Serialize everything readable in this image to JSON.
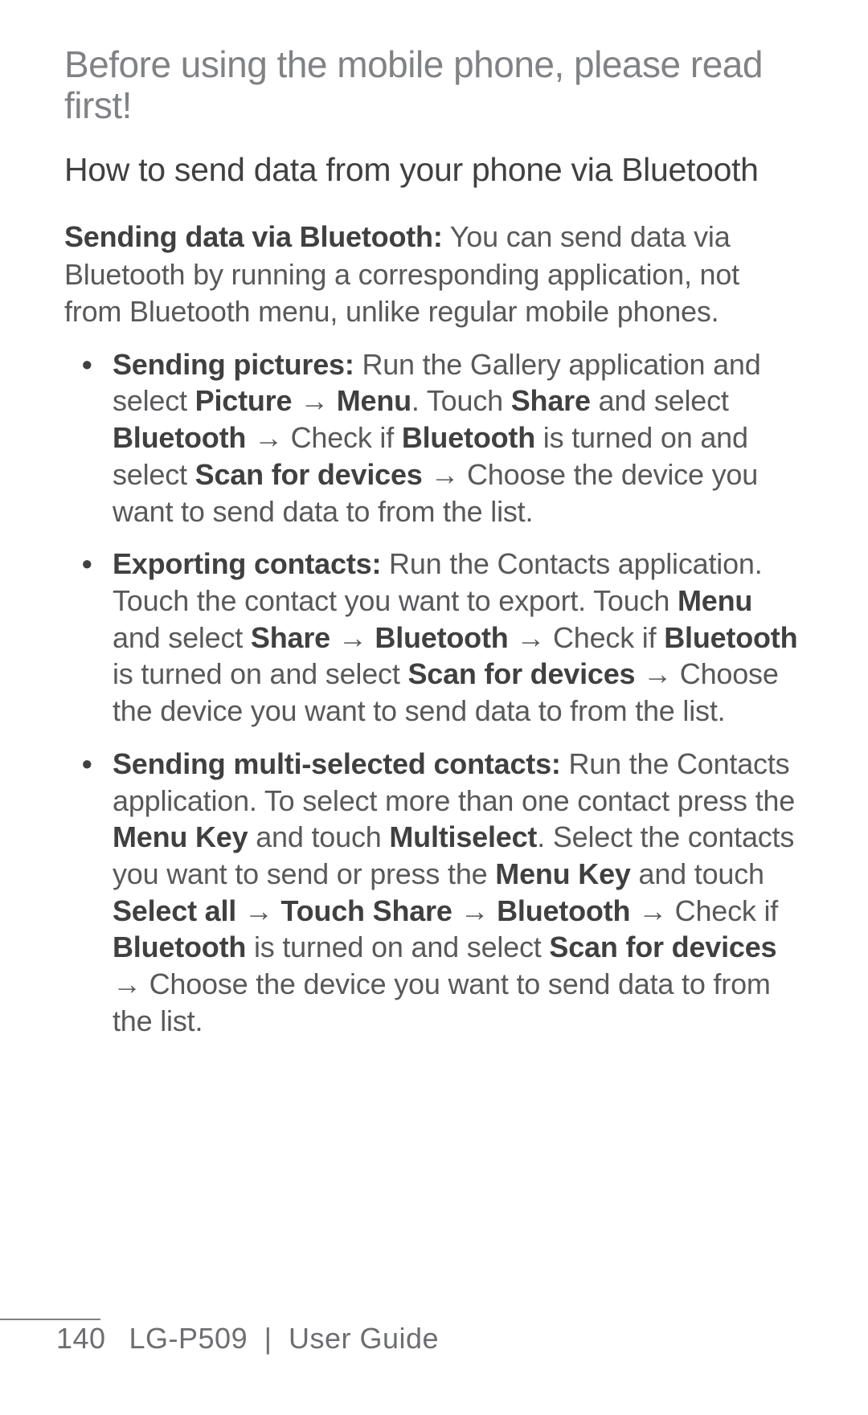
{
  "title": "Before using the mobile phone, please read first!",
  "subtitle": "How to send data from your phone via Bluetooth",
  "intro": {
    "lead_bold": "Sending data via Bluetooth:",
    "lead_rest": " You can send data via Bluetooth by running a corresponding application, not from Bluetooth menu, unlike regular mobile phones."
  },
  "items": [
    {
      "parts": [
        {
          "t": "Sending pictures:",
          "b": true
        },
        {
          "t": " Run the Gallery application and select "
        },
        {
          "t": "Picture",
          "b": true
        },
        {
          "t": " → "
        },
        {
          "t": "Menu",
          "b": true
        },
        {
          "t": ". Touch "
        },
        {
          "t": "Share",
          "b": true
        },
        {
          "t": " and select "
        },
        {
          "t": "Bluetooth",
          "b": true
        },
        {
          "t": " → Check if "
        },
        {
          "t": "Bluetooth",
          "b": true
        },
        {
          "t": " is turned on and select "
        },
        {
          "t": "Scan for devices",
          "b": true
        },
        {
          "t": " → Choose the device you want to send data to from the list."
        }
      ]
    },
    {
      "parts": [
        {
          "t": "Exporting contacts:",
          "b": true
        },
        {
          "t": " Run the Contacts application. Touch the contact you want to export. Touch "
        },
        {
          "t": "Menu",
          "b": true
        },
        {
          "t": " and select "
        },
        {
          "t": "Share",
          "b": true
        },
        {
          "t": " → "
        },
        {
          "t": "Bluetooth",
          "b": true
        },
        {
          "t": " → Check if "
        },
        {
          "t": "Bluetooth",
          "b": true
        },
        {
          "t": " is turned on and select "
        },
        {
          "t": "Scan for devices",
          "b": true
        },
        {
          "t": " → Choose the device you want to send data to from the list."
        }
      ]
    },
    {
      "parts": [
        {
          "t": "Sending multi-selected contacts:",
          "b": true
        },
        {
          "t": " Run the Contacts application. To select more than one contact press the "
        },
        {
          "t": "Menu Key",
          "b": true
        },
        {
          "t": " and touch "
        },
        {
          "t": "Multiselect",
          "b": true
        },
        {
          "t": ". Select the contacts you want to send or press the "
        },
        {
          "t": "Menu Key",
          "b": true
        },
        {
          "t": " and touch "
        },
        {
          "t": "Select all",
          "b": true
        },
        {
          "t": " → "
        },
        {
          "t": "Touch Share",
          "b": true
        },
        {
          "t": " → "
        },
        {
          "t": "Bluetooth",
          "b": true
        },
        {
          "t": " → Check if "
        },
        {
          "t": "Bluetooth",
          "b": true
        },
        {
          "t": " is turned on and select "
        },
        {
          "t": "Scan for devices",
          "b": true
        },
        {
          "t": " → Choose the device you want to send data to from the list."
        }
      ]
    }
  ],
  "footer": {
    "page_number": "140",
    "model": "LG-P509",
    "separator": "|",
    "label": "User Guide"
  }
}
